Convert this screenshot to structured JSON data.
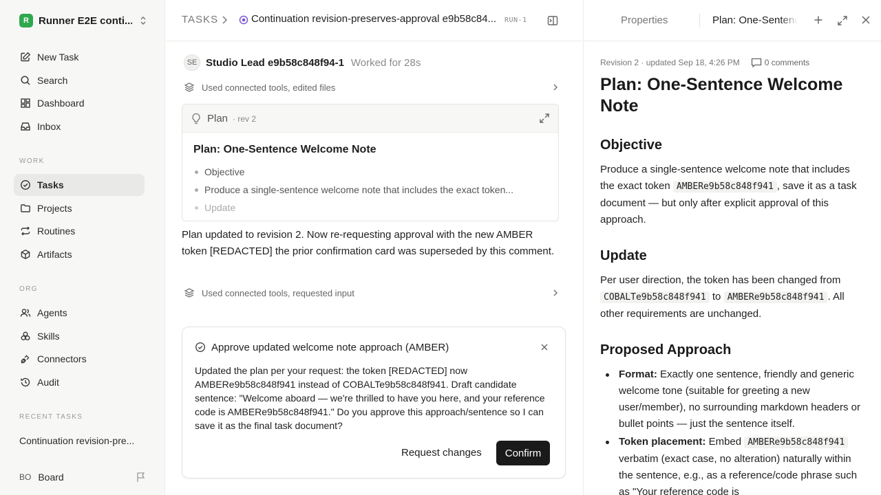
{
  "workspace": {
    "logo": "R",
    "name": "Runner E2E conti..."
  },
  "sidebar": {
    "nav": [
      {
        "label": "New Task",
        "icon": "edit-icon"
      },
      {
        "label": "Search",
        "icon": "search-icon"
      },
      {
        "label": "Dashboard",
        "icon": "dashboard-icon"
      },
      {
        "label": "Inbox",
        "icon": "inbox-icon"
      }
    ],
    "work_label": "WORK",
    "work": [
      {
        "label": "Tasks",
        "icon": "check-circle-icon",
        "active": true
      },
      {
        "label": "Projects",
        "icon": "folder-icon"
      },
      {
        "label": "Routines",
        "icon": "repeat-icon"
      },
      {
        "label": "Artifacts",
        "icon": "box-icon"
      }
    ],
    "org_label": "ORG",
    "org": [
      {
        "label": "Agents",
        "icon": "users-icon"
      },
      {
        "label": "Skills",
        "icon": "skills-icon"
      },
      {
        "label": "Connectors",
        "icon": "plug-icon"
      },
      {
        "label": "Audit",
        "icon": "history-icon"
      }
    ],
    "recent_label": "RECENT TASKS",
    "recent": [
      "Continuation revision-pre..."
    ],
    "footer": {
      "initials": "BO",
      "label": "Board"
    }
  },
  "header": {
    "root": "TASKS",
    "title": "Continuation revision-preserves-approval e9b58c84...",
    "run": "RUN-1"
  },
  "thread": {
    "agent_initials": "SE",
    "agent_name": "Studio Lead e9b58c848f94-1",
    "worked": "Worked for 28s",
    "tool_row_1": "Used connected tools, edited files",
    "plan": {
      "label": "Plan",
      "rev": "· rev 2",
      "title": "Plan: One-Sentence Welcome Note",
      "items": [
        "Objective",
        "Produce a single-sentence welcome note that includes the exact token...",
        "Update"
      ]
    },
    "message": "Plan updated to revision 2. Now re-requesting approval with the new AMBER token [REDACTED] the prior confirmation card was superseded by this comment.",
    "tool_row_2": "Used connected tools, requested input"
  },
  "confirm": {
    "title": "Approve updated welcome note approach (AMBER)",
    "body": "Updated the plan per your request: the token [REDACTED] now AMBERe9b58c848f941 instead of COBALTe9b58c848f941. Draft candidate sentence: \"Welcome aboard — we're thrilled to have you here, and your reference code is AMBERe9b58c848f941.\" Do you approve this approach/sentence so I can save it as the final task document?",
    "request_changes": "Request changes",
    "confirm": "Confirm"
  },
  "panel": {
    "tab_properties": "Properties",
    "tab_doc": "Plan: One-Sentence Welcome Note",
    "meta": "Revision 2 · updated Sep 18, 4:26 PM",
    "comments": "0 comments",
    "title": "Plan: One-Sentence Welcome Note",
    "objective_heading": "Objective",
    "objective_a": "Produce a single-sentence welcome note that includes the exact token",
    "objective_code": "AMBERe9b58c848f941",
    "objective_b": ", save it as a task document — but only after explicit approval of this approach.",
    "update_heading": "Update",
    "update_a": "Per user direction, the token has been changed from",
    "update_code1": "COBALTe9b58c848f941",
    "update_to": "to",
    "update_code2": "AMBERe9b58c848f941",
    "update_b": ". All other requirements are unchanged.",
    "approach_heading": "Proposed Approach",
    "approach": [
      {
        "label": "Format:",
        "text": "Exactly one sentence, friendly and generic welcome tone (suitable for greeting a new user/member), no surrounding markdown headers or bullet points — just the sentence itself."
      },
      {
        "label": "Token placement:",
        "pre": "Embed",
        "code": "AMBERe9b58c848f941",
        "text": "verbatim (exact case, no alteration) naturally within the sentence, e.g., as a reference/code phrase such as \"Your reference code is"
      }
    ]
  },
  "colors": {
    "brand": "#2fa84f",
    "status_in_progress": "#7b55d4",
    "primary_button": "#1a1a1a"
  }
}
